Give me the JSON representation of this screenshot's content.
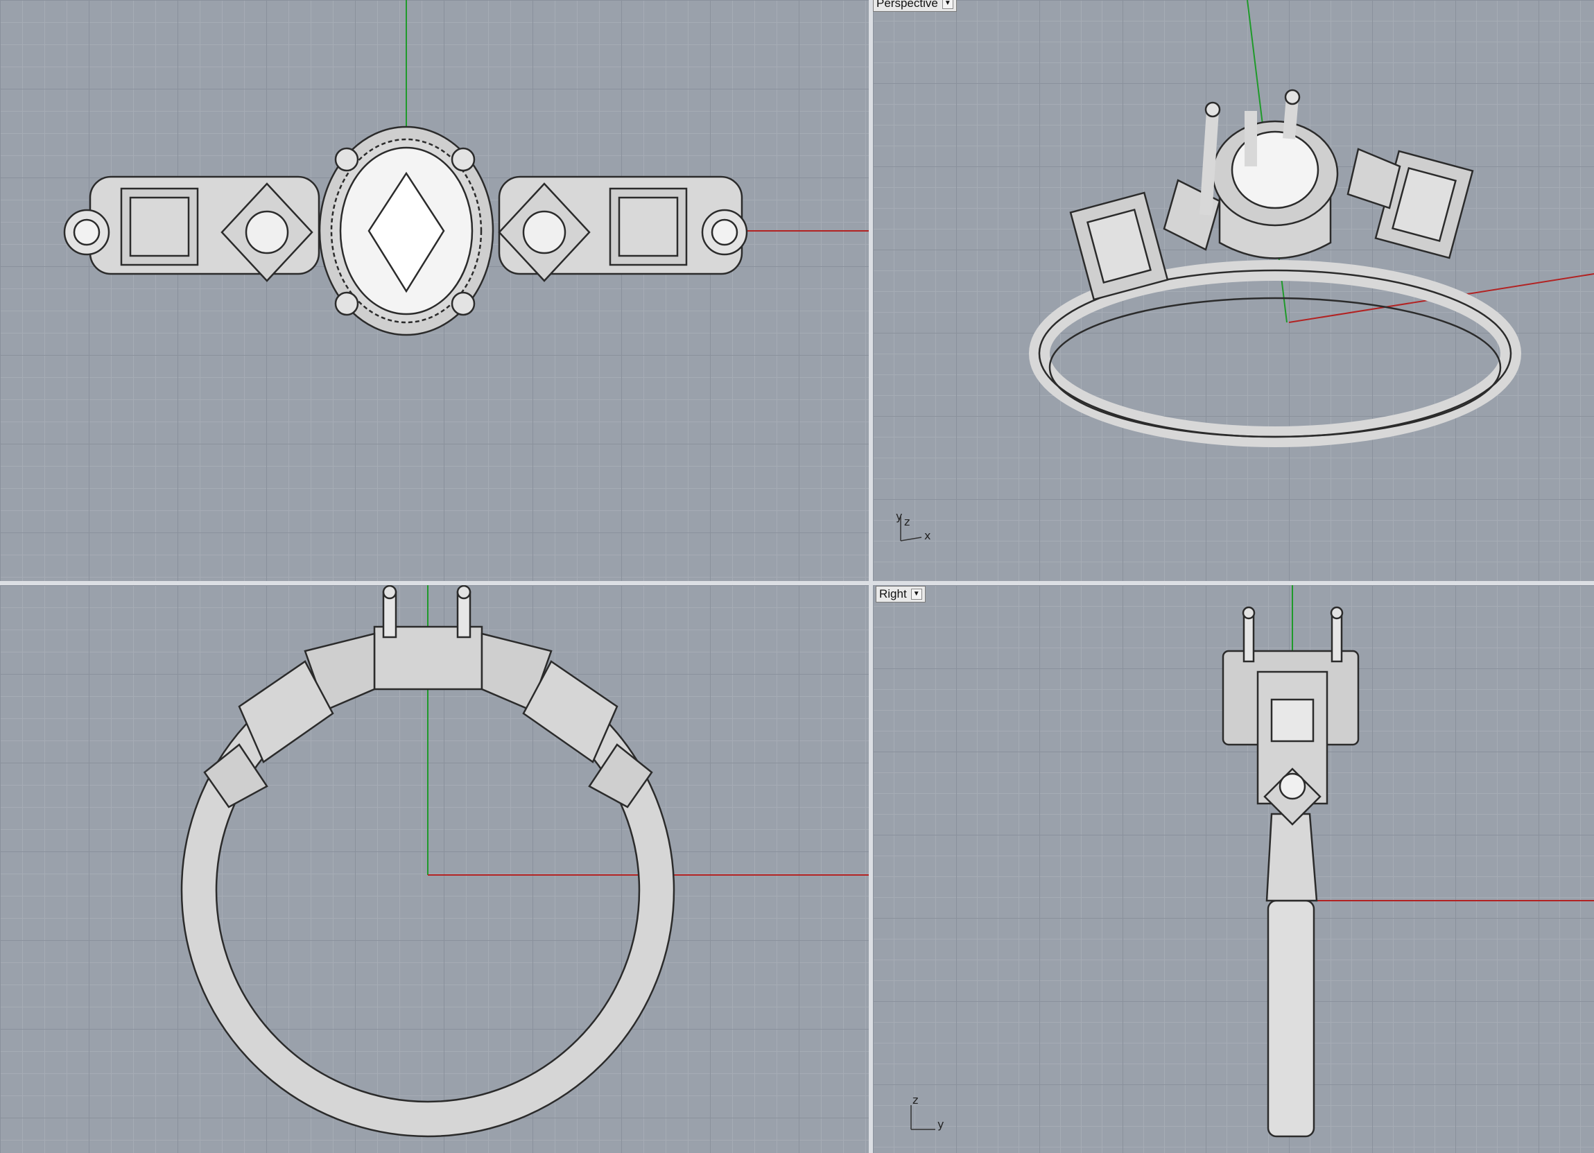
{
  "viewports": {
    "top": {
      "label": ""
    },
    "perspective": {
      "label": "Perspective",
      "axis_x": "x",
      "axis_y": "y",
      "axis_z": "z"
    },
    "front": {
      "label": ""
    },
    "right": {
      "label": "Right",
      "axis_z": "z",
      "axis_y": "y"
    }
  },
  "colors": {
    "grid_bg": "#9aa1ab",
    "grid_minor": "#a6acb5",
    "grid_major": "#8a919c",
    "x_axis": "#b22222",
    "y_axis": "#1f9a2a",
    "model_fill": "#e6e6e6",
    "model_stroke": "#2b2b2b",
    "divider": "#dcdfe4"
  },
  "icons": {
    "tab_menu": "chevron-down-icon"
  }
}
